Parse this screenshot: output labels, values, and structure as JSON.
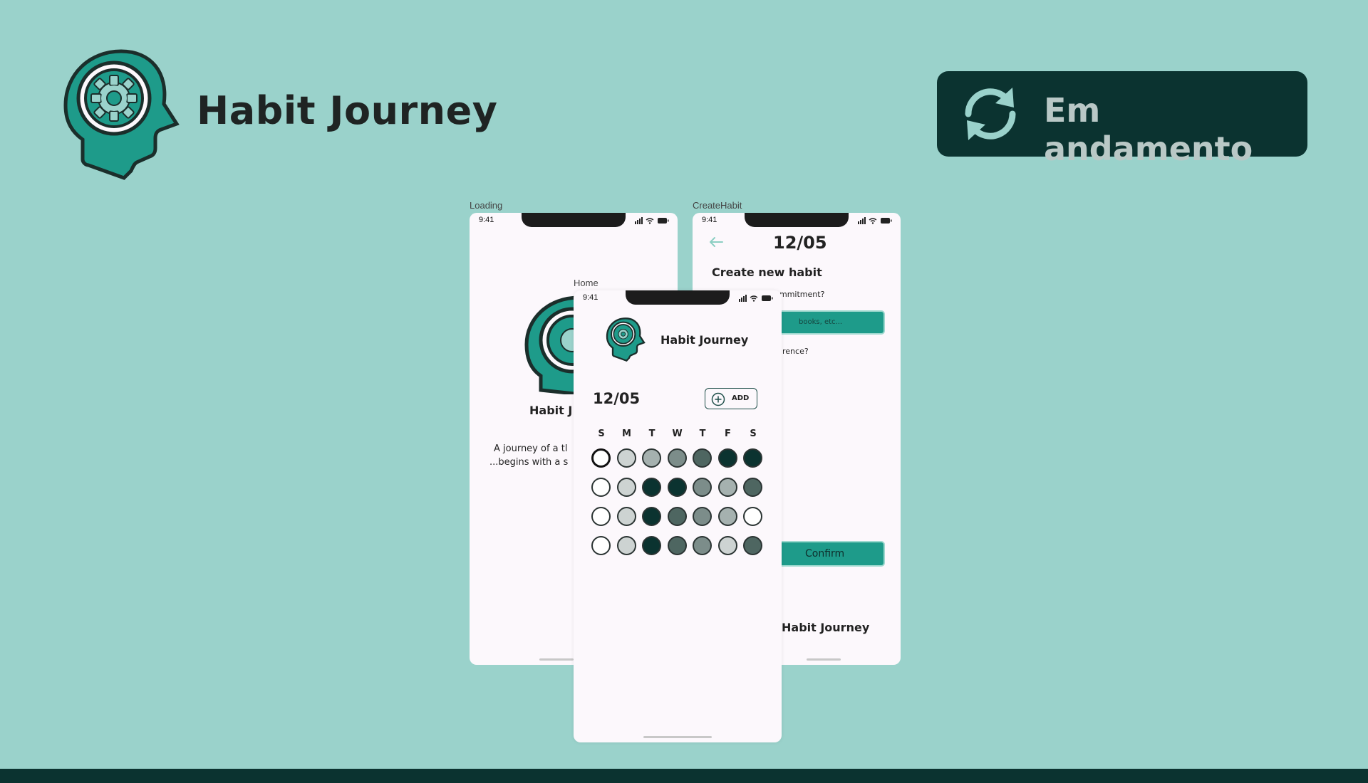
{
  "header": {
    "app_title": "Habit Journey",
    "status_label": "Em andamento"
  },
  "colors": {
    "background": "#9AD2CB",
    "dark": "#0B3330",
    "accent": "#1E9B8A",
    "phone_bg": "#FCF8FC"
  },
  "icons": {
    "logo": "head-gear-icon",
    "status": "sync-icon",
    "back": "arrow-left-icon",
    "add": "plus-circle-icon"
  },
  "screens": {
    "loading": {
      "frame_label": "Loading",
      "time": "9:41",
      "title": "Habit J",
      "tagline_line1": "A journey of a tl",
      "tagline_line2": "...begins with a s"
    },
    "create": {
      "frame_label": "CreateHabit",
      "time": "9:41",
      "date": "12/05",
      "heading": "Create new habit",
      "question1": "mmitment?",
      "input_placeholder": "books, etc...",
      "question2": "rence?",
      "confirm_label": "Confirm",
      "footer": "Habit Journey"
    },
    "home": {
      "frame_label": "Home",
      "time": "9:41",
      "app_name": "Habit Journey",
      "date": "12/05",
      "add_label": "ADD",
      "weekdays": [
        "S",
        "M",
        "T",
        "W",
        "T",
        "F",
        "S"
      ],
      "grid_levels": [
        [
          -1,
          1,
          2,
          3,
          4,
          5,
          5
        ],
        [
          0,
          1,
          5,
          5,
          3,
          2,
          4
        ],
        [
          0,
          1,
          5,
          4,
          3,
          2,
          0
        ],
        [
          0,
          1,
          5,
          4,
          3,
          1,
          4
        ]
      ]
    }
  }
}
